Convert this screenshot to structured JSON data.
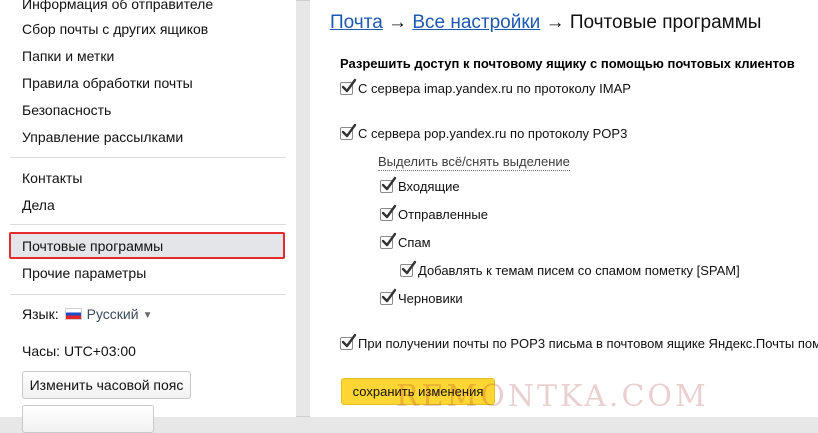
{
  "sidebar": {
    "items_top": [
      "Информация об отправителе",
      "Сбор почты с других ящиков",
      "Папки и метки",
      "Правила обработки почты",
      "Безопасность",
      "Управление рассылками"
    ],
    "items_mid": [
      "Контакты",
      "Дела"
    ],
    "items_bottom": [
      "Почтовые программы",
      "Прочие параметры"
    ],
    "language_label": "Язык:",
    "language_value": "Русский",
    "timezone_label": "Часы:",
    "timezone_value": "UTC+03:00",
    "change_timezone_button": "Изменить часовой пояс"
  },
  "breadcrumb": {
    "link1": "Почта",
    "sep": "→",
    "link2": "Все настройки",
    "current": "Почтовые программы"
  },
  "content": {
    "section_title": "Разрешить доступ к почтовому ящику с помощью почтовых клиентов",
    "imap_option": "С сервера imap.yandex.ru по протоколу IMAP",
    "pop3_option": "С сервера pop.yandex.ru по протоколу POP3",
    "select_all_link": "Выделить всё/снять выделение",
    "folders": {
      "inbox": "Входящие",
      "sent": "Отправленные",
      "spam": "Спам",
      "spam_tag": "Добавлять к темам писем со спамом пометку [SPAM]",
      "drafts": "Черновики"
    },
    "pop3_note": "При получении почты по POP3 письма в почтовом ящике Яндекс.Почты пом",
    "save_button": "сохранить изменения"
  },
  "watermark": "REMONTKA.COM",
  "colors": {
    "link": "#1d58b0",
    "highlight_border": "#e52b2b",
    "save_button": "#ffd633",
    "checkmark": "#333333"
  },
  "icons": {
    "checkbox": "checkbox-checked-icon",
    "flag": "russia-flag-icon",
    "caret": "caret-down-icon"
  }
}
